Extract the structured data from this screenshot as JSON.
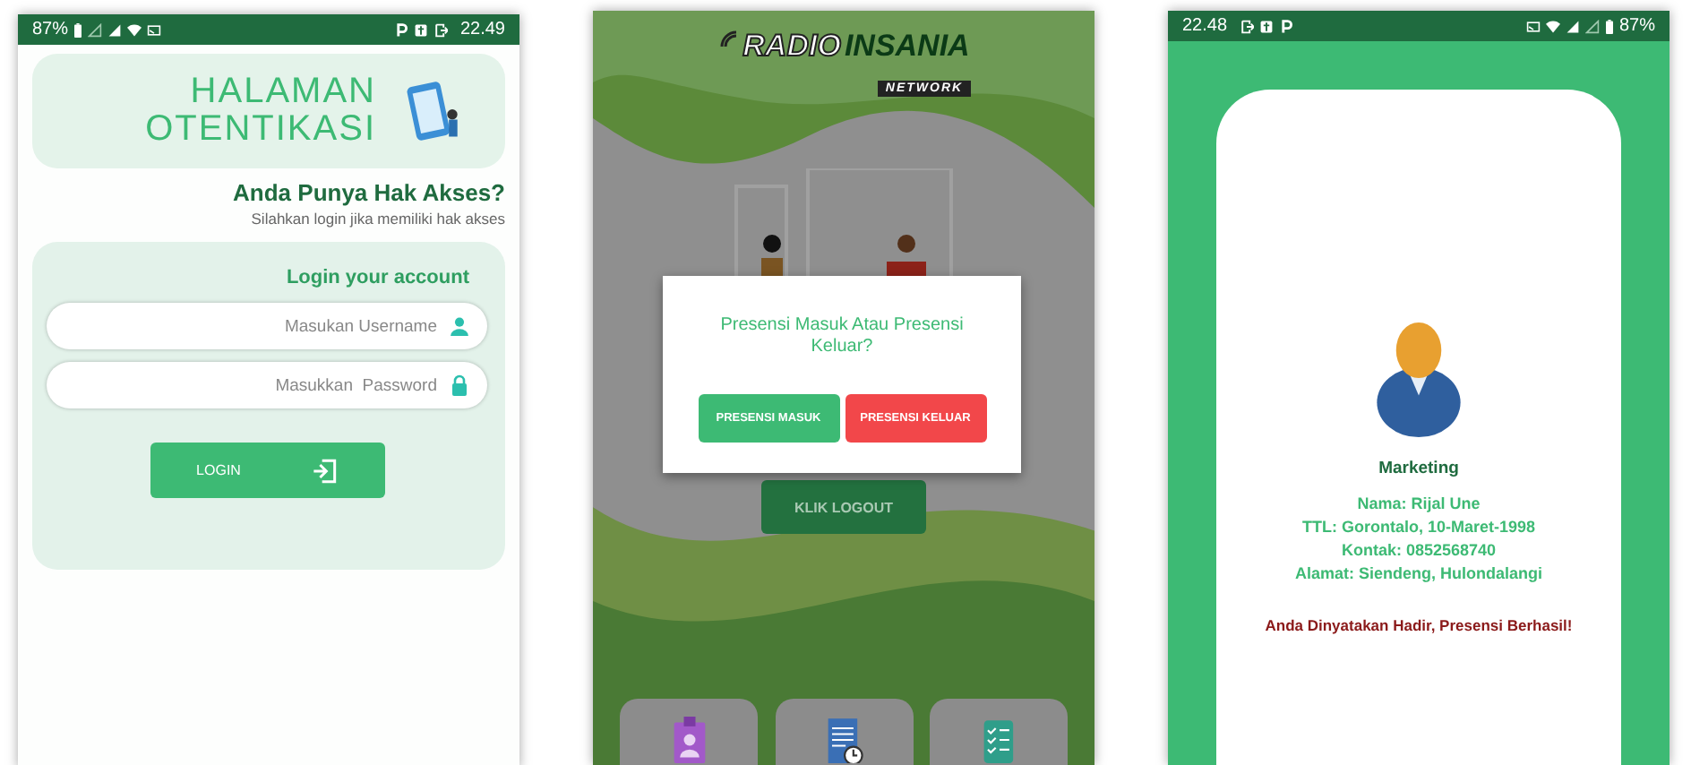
{
  "login_screen": {
    "status_bar": {
      "time": "22.49",
      "battery": "87%"
    },
    "header": {
      "title_line_1": "HALAMAN",
      "title_line_2": "OTENTIKASI"
    },
    "heading": "Anda Punya Hak Akses?",
    "subheading": "Silahkan login jika memiliki hak akses",
    "form": {
      "title": "Login your account",
      "username_placeholder": "Masukan Username",
      "password_placeholder": "Masukkan  Password",
      "login_button": "LOGIN"
    }
  },
  "presence_screen": {
    "logo": {
      "word_1": "RADIO",
      "word_2": "INSANIA",
      "tagline": "NETWORK"
    },
    "logout_button": "KLIK LOGOUT",
    "dialog": {
      "message": "Presensi Masuk Atau Presensi Keluar?",
      "buttons": [
        {
          "label": "PRESENSI MASUK",
          "color": "#3dba74"
        },
        {
          "label": "PRESENSI KELUAR",
          "color": "#f2474a"
        }
      ]
    }
  },
  "profile_screen": {
    "status_bar": {
      "time": "22.48",
      "battery": "87%"
    },
    "role": "Marketing",
    "details": [
      "Nama: Rijal Une",
      "TTL: Gorontalo, 10-Maret-1998",
      "Kontak: 0852568740",
      "Alamat: Siendeng, Hulondalangi"
    ],
    "message": "Anda Dinyatakan Hadir, Presensi Berhasil!"
  }
}
